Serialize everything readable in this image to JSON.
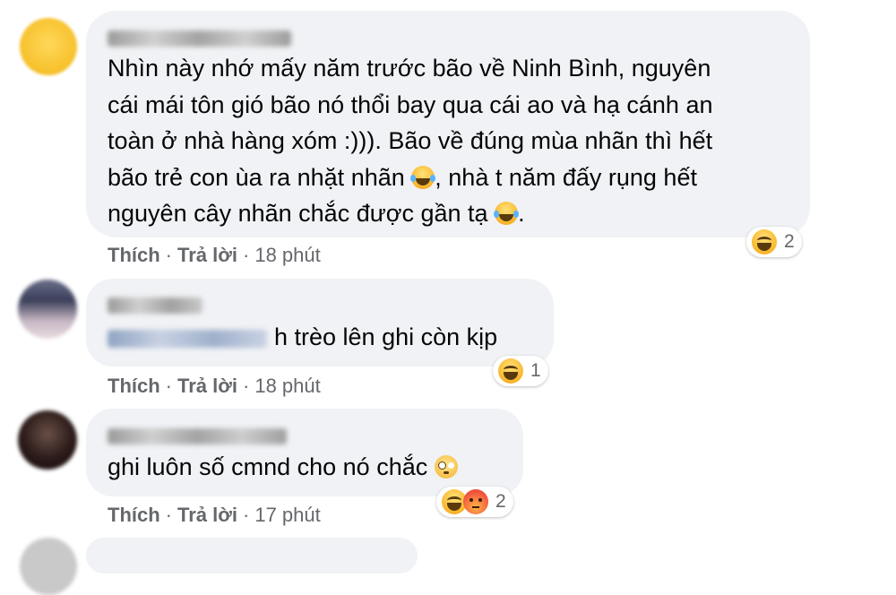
{
  "comments": [
    {
      "text_lines": [
        "Nhìn này nhớ mấy năm trước bão về Ninh Bình, nguyên",
        "cái mái tôn gió bão nó thổi bay qua cái ao và hạ cánh an",
        "toàn ở nhà hàng xóm :))). Bão về đúng mùa nhãn thì hết",
        "bão trẻ con ùa ra nhặt nhãn",
        ", nhà t năm đấy rụng hết",
        "nguyên cây nhãn chắc được gần tạ"
      ],
      "like_label": "Thích",
      "reply_label": "Trả lời",
      "separator": "·",
      "time": "18 phút",
      "reaction_count": "2",
      "reaction_icons": [
        "haha"
      ]
    },
    {
      "text": "h trèo lên ghi còn kịp",
      "like_label": "Thích",
      "reply_label": "Trả lời",
      "separator": "·",
      "time": "18 phút",
      "reaction_count": "1",
      "reaction_icons": [
        "haha"
      ]
    },
    {
      "text": "ghi luôn số cmnd cho nó chắc",
      "like_label": "Thích",
      "reply_label": "Trả lời",
      "separator": "·",
      "time": "17 phút",
      "reaction_count": "2",
      "reaction_icons": [
        "haha",
        "angry"
      ]
    }
  ],
  "colors": {
    "bubble": "#f0f2f5",
    "meta_text": "#65676b",
    "text": "#050505"
  }
}
